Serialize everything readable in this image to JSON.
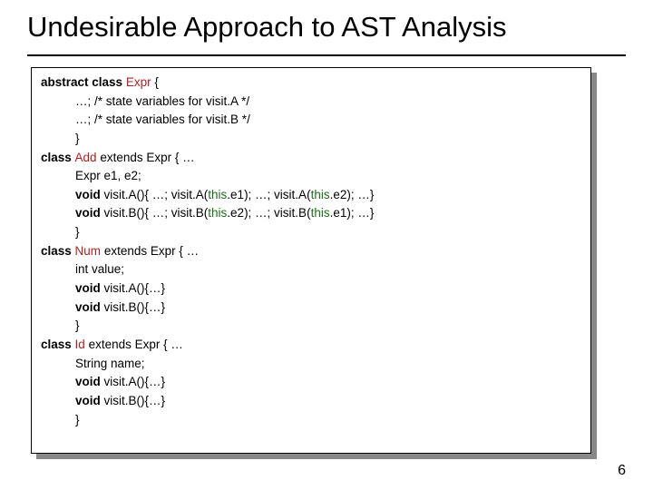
{
  "title": "Undesirable Approach to AST Analysis",
  "code": {
    "l01a": "abstract class ",
    "l01b": "Expr",
    "l01c": " {",
    "l02": "…; /* state variables for visit.A */",
    "l03": "…; /* state variables for visit.B */",
    "l04": "}",
    "l05a": "class ",
    "l05b": "Add",
    "l05c": " extends Expr { …",
    "l06": "Expr e1, e2;",
    "l07a": "void",
    "l07b": " visit.A(){ …; visit.A(",
    "l07c": "this",
    "l07d": ".e1); …; visit.A(",
    "l07e": "this",
    "l07f": ".e2); …}",
    "l08a": "void",
    "l08b": " visit.B(){ …; visit.B(",
    "l08c": "this",
    "l08d": ".e2); …; visit.B(",
    "l08e": "this",
    "l08f": ".e1); …}",
    "l09": "}",
    "l10a": "class ",
    "l10b": "Num",
    "l10c": " extends Expr { …",
    "l11": "int value;",
    "l12a": "void",
    "l12b": " visit.A(){…}",
    "l13a": "void",
    "l13b": " visit.B(){…}",
    "l14": "}",
    "l15a": "class ",
    "l15b": "Id",
    "l15c": " extends Expr { …",
    "l16": "String name;",
    "l17a": "void",
    "l17b": " visit.A(){…}",
    "l18a": "void",
    "l18b": " visit.B(){…}",
    "l19": "}"
  },
  "page_number": "6"
}
